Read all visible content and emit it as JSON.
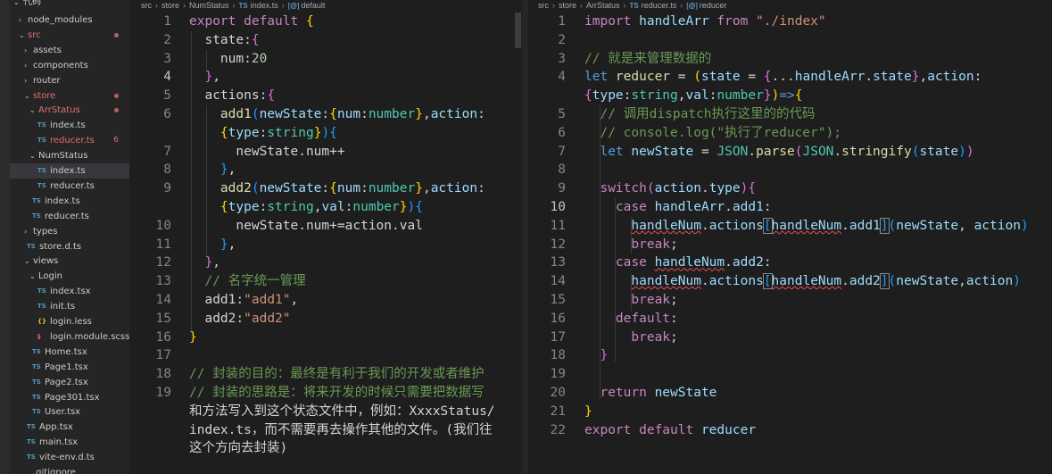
{
  "sidebar": {
    "root_label": "代码",
    "items": [
      {
        "label": "node_modules",
        "chevron": "›",
        "icon": ""
      },
      {
        "label": "src",
        "chevron": "⌄",
        "icon": "",
        "red": true
      },
      {
        "label": "assets",
        "chevron": "›",
        "icon": ""
      },
      {
        "label": "components",
        "chevron": "›",
        "icon": ""
      },
      {
        "label": "router",
        "chevron": "›",
        "icon": ""
      },
      {
        "label": "store",
        "chevron": "⌄",
        "icon": "",
        "red": true
      },
      {
        "label": "ArrStatus",
        "chevron": "⌄",
        "icon": "",
        "red": true
      },
      {
        "label": "index.ts",
        "chevron": "",
        "icon": "TS"
      },
      {
        "label": "reducer.ts",
        "chevron": "",
        "icon": "TS",
        "red": true,
        "count": "6"
      },
      {
        "label": "NumStatus",
        "chevron": "⌄",
        "icon": ""
      },
      {
        "label": "index.ts",
        "chevron": "",
        "icon": "TS",
        "selected": true
      },
      {
        "label": "reducer.ts",
        "chevron": "",
        "icon": "TS"
      },
      {
        "label": "index.ts",
        "chevron": "",
        "icon": "TS"
      },
      {
        "label": "reducer.ts",
        "chevron": "",
        "icon": "TS"
      },
      {
        "label": "types",
        "chevron": "›",
        "icon": ""
      },
      {
        "label": "store.d.ts",
        "chevron": "",
        "icon": "TS"
      },
      {
        "label": "views",
        "chevron": "⌄",
        "icon": ""
      },
      {
        "label": "Login",
        "chevron": "⌄",
        "icon": ""
      },
      {
        "label": "index.tsx",
        "chevron": "",
        "icon": "TS"
      },
      {
        "label": "init.ts",
        "chevron": "",
        "icon": "TS"
      },
      {
        "label": "login.less",
        "chevron": "",
        "icon": "{}"
      },
      {
        "label": "login.module.scss",
        "chevron": "",
        "icon": "scss"
      },
      {
        "label": "Home.tsx",
        "chevron": "",
        "icon": "TS"
      },
      {
        "label": "Page1.tsx",
        "chevron": "",
        "icon": "TS"
      },
      {
        "label": "Page2.tsx",
        "chevron": "",
        "icon": "TS"
      },
      {
        "label": "Page301.tsx",
        "chevron": "",
        "icon": "TS"
      },
      {
        "label": "User.tsx",
        "chevron": "",
        "icon": "TS"
      },
      {
        "label": "App.tsx",
        "chevron": "",
        "icon": "TS"
      },
      {
        "label": "main.tsx",
        "chevron": "",
        "icon": "TS"
      },
      {
        "label": "vite-env.d.ts",
        "chevron": "",
        "icon": "TS"
      },
      {
        "label": ".gitignore",
        "chevron": "",
        "icon": ""
      }
    ]
  },
  "left": {
    "breadcrumb": {
      "a": "src",
      "b": "store",
      "c": "NumStatus",
      "file_icon": "TS",
      "file": "index.ts",
      "symbol_icon": "[@]",
      "symbol": "default"
    },
    "current_line": "4",
    "lines": [
      {
        "n": "1",
        "t": [
          [
            "export default ",
            "kw"
          ],
          [
            "{",
            "p1"
          ]
        ]
      },
      {
        "n": "2",
        "t": [
          [
            "  state",
            ""
          ],
          [
            ":",
            ""
          ],
          [
            "{",
            "p2"
          ]
        ]
      },
      {
        "n": "3",
        "t": [
          [
            "    num",
            ""
          ],
          [
            ":",
            ""
          ],
          [
            "20",
            "num"
          ]
        ]
      },
      {
        "n": "4",
        "t": [
          [
            "  ",
            ""
          ],
          [
            "}",
            "p2"
          ],
          [
            ",",
            ""
          ]
        ]
      },
      {
        "n": "5",
        "t": [
          [
            "  actions",
            ""
          ],
          [
            ":",
            ""
          ],
          [
            "{",
            "p2"
          ]
        ]
      },
      {
        "n": "6",
        "t": [
          [
            "    ",
            ""
          ],
          [
            "add1",
            "fn"
          ],
          [
            "(",
            "p3"
          ],
          [
            "newState",
            "var"
          ],
          [
            ":",
            ""
          ],
          [
            "{",
            "p1"
          ],
          [
            "num",
            "var"
          ],
          [
            ":",
            ""
          ],
          [
            "number",
            "ty"
          ],
          [
            "}",
            "p1"
          ],
          [
            ",",
            ""
          ],
          [
            "action",
            "var"
          ],
          [
            ":",
            ""
          ]
        ]
      },
      {
        "n": "",
        "t": [
          [
            "    ",
            ""
          ],
          [
            "{",
            "p1"
          ],
          [
            "type",
            "var"
          ],
          [
            ":",
            ""
          ],
          [
            "string",
            "ty"
          ],
          [
            "}",
            "p1"
          ],
          [
            ")",
            "p3"
          ],
          [
            "{",
            "p3"
          ]
        ]
      },
      {
        "n": "7",
        "t": [
          [
            "      newState",
            ""
          ],
          [
            ".",
            ""
          ],
          [
            "num",
            ""
          ],
          [
            "++",
            ""
          ]
        ]
      },
      {
        "n": "8",
        "t": [
          [
            "    ",
            ""
          ],
          [
            "}",
            "p3"
          ],
          [
            ",",
            ""
          ]
        ]
      },
      {
        "n": "9",
        "t": [
          [
            "    ",
            ""
          ],
          [
            "add2",
            "fn"
          ],
          [
            "(",
            "p3"
          ],
          [
            "newState",
            "var"
          ],
          [
            ":",
            ""
          ],
          [
            "{",
            "p1"
          ],
          [
            "num",
            "var"
          ],
          [
            ":",
            ""
          ],
          [
            "number",
            "ty"
          ],
          [
            "}",
            "p1"
          ],
          [
            ",",
            ""
          ],
          [
            "action",
            "var"
          ],
          [
            ":",
            ""
          ]
        ]
      },
      {
        "n": "",
        "t": [
          [
            "    ",
            ""
          ],
          [
            "{",
            "p1"
          ],
          [
            "type",
            "var"
          ],
          [
            ":",
            ""
          ],
          [
            "string",
            "ty"
          ],
          [
            ",",
            ""
          ],
          [
            "val",
            "var"
          ],
          [
            ":",
            ""
          ],
          [
            "number",
            "ty"
          ],
          [
            "}",
            "p1"
          ],
          [
            ")",
            "p3"
          ],
          [
            "{",
            "p3"
          ]
        ]
      },
      {
        "n": "10",
        "t": [
          [
            "      newState",
            ""
          ],
          [
            ".",
            ""
          ],
          [
            "num",
            ""
          ],
          [
            "+=",
            ""
          ],
          [
            "action",
            ""
          ],
          [
            ".",
            ""
          ],
          [
            "val",
            ""
          ]
        ]
      },
      {
        "n": "11",
        "t": [
          [
            "    ",
            ""
          ],
          [
            "}",
            "p3"
          ],
          [
            ",",
            ""
          ]
        ]
      },
      {
        "n": "12",
        "t": [
          [
            "  ",
            ""
          ],
          [
            "}",
            "p2"
          ],
          [
            ",",
            ""
          ]
        ]
      },
      {
        "n": "13",
        "t": [
          [
            "  // 名字统一管理",
            "cm"
          ]
        ]
      },
      {
        "n": "14",
        "t": [
          [
            "  add1",
            ""
          ],
          [
            ":",
            ""
          ],
          [
            "\"add1\"",
            "str"
          ],
          [
            ",",
            ""
          ]
        ]
      },
      {
        "n": "15",
        "t": [
          [
            "  add2",
            ""
          ],
          [
            ":",
            ""
          ],
          [
            "\"add2\"",
            "str"
          ]
        ]
      },
      {
        "n": "16",
        "t": [
          [
            "",
            "op"
          ],
          [
            "}",
            "p1"
          ]
        ]
      },
      {
        "n": "17",
        "t": []
      },
      {
        "n": "18",
        "t": [
          [
            "// 封装的目的：最终是有利于我们的开发或者维护",
            "cm"
          ]
        ]
      },
      {
        "n": "19",
        "t": [
          [
            "// 封装的思路是：将来开发的时候只需要把数据写",
            "cm"
          ]
        ]
      },
      {
        "n": "",
        "t": [
          [
            "和方法写入到这个状态文件中，例如：XxxxStatus/",
            ""
          ]
        ]
      },
      {
        "n": "",
        "t": [
          [
            "index.ts，而不需要再去操作其他的文件。(我们往",
            ""
          ]
        ]
      },
      {
        "n": "",
        "t": [
          [
            "这个方向去封装)",
            ""
          ]
        ]
      }
    ]
  },
  "right": {
    "breadcrumb": {
      "a": "src",
      "b": "store",
      "c": "ArrStatus",
      "file_icon": "TS",
      "file": "reducer.ts",
      "symbol_icon": "[@]",
      "symbol": "reducer"
    },
    "current_line": "10",
    "lines": [
      {
        "n": "1",
        "t": [
          [
            "import ",
            "kw"
          ],
          [
            "handleArr",
            "var"
          ],
          [
            " from ",
            "kw"
          ],
          [
            "\"./index\"",
            "str"
          ]
        ]
      },
      {
        "n": "2",
        "t": []
      },
      {
        "n": "3",
        "t": [
          [
            "// 就是来管理数据的",
            "cm"
          ]
        ]
      },
      {
        "n": "4",
        "t": [
          [
            "let ",
            "kb"
          ],
          [
            "reducer",
            "fn"
          ],
          [
            " = ",
            ""
          ],
          [
            "(",
            "p1"
          ],
          [
            "state",
            "var"
          ],
          [
            " = ",
            ""
          ],
          [
            "{",
            "p2"
          ],
          [
            "...",
            ""
          ],
          [
            "handleArr",
            "var"
          ],
          [
            ".",
            ""
          ],
          [
            "state",
            "var"
          ],
          [
            "}",
            "p2"
          ],
          [
            ",",
            ""
          ],
          [
            "action",
            "var"
          ],
          [
            ":",
            ""
          ]
        ]
      },
      {
        "n": "",
        "t": [
          [
            "{",
            "p2"
          ],
          [
            "type",
            "var"
          ],
          [
            ":",
            ""
          ],
          [
            "string",
            "ty"
          ],
          [
            ",",
            ""
          ],
          [
            "val",
            "var"
          ],
          [
            ":",
            ""
          ],
          [
            "number",
            "ty"
          ],
          [
            "}",
            "p2"
          ],
          [
            ")",
            "p1"
          ],
          [
            "=>",
            "kb"
          ],
          [
            "{",
            "p1"
          ]
        ]
      },
      {
        "n": "5",
        "t": [
          [
            "  // 调用dispatch执行这里的的代码",
            "cm"
          ]
        ]
      },
      {
        "n": "6",
        "t": [
          [
            "  // console.log(\"执行了reducer\");",
            "cm"
          ]
        ]
      },
      {
        "n": "7",
        "t": [
          [
            "  ",
            ""
          ],
          [
            "let ",
            "kb"
          ],
          [
            "newState",
            "var"
          ],
          [
            " = ",
            ""
          ],
          [
            "JSON",
            "ty"
          ],
          [
            ".",
            ""
          ],
          [
            "parse",
            "fn"
          ],
          [
            "(",
            "p2"
          ],
          [
            "JSON",
            "ty"
          ],
          [
            ".",
            ""
          ],
          [
            "stringify",
            "fn"
          ],
          [
            "(",
            "p3"
          ],
          [
            "state",
            "var"
          ],
          [
            ")",
            "p3"
          ],
          [
            ")",
            "p2"
          ]
        ]
      },
      {
        "n": "8",
        "t": []
      },
      {
        "n": "9",
        "t": [
          [
            "  ",
            ""
          ],
          [
            "switch",
            "kw"
          ],
          [
            "(",
            "p2"
          ],
          [
            "action",
            "var"
          ],
          [
            ".",
            ""
          ],
          [
            "type",
            "var"
          ],
          [
            ")",
            "p2"
          ],
          [
            "{",
            "p2"
          ]
        ]
      },
      {
        "n": "10",
        "t": [
          [
            "    ",
            ""
          ],
          [
            "case ",
            "kw"
          ],
          [
            "handleArr",
            "var"
          ],
          [
            ".",
            ""
          ],
          [
            "add1",
            "var"
          ],
          [
            ":",
            ""
          ]
        ]
      },
      {
        "n": "11",
        "t": [
          [
            "      ",
            ""
          ],
          [
            "handleNum",
            "var sq"
          ],
          [
            ".",
            ""
          ],
          [
            "actions",
            "var"
          ],
          [
            "[",
            "p3 bx"
          ],
          [
            "handleNum",
            "var sq"
          ],
          [
            ".",
            ""
          ],
          [
            "add1",
            "var"
          ],
          [
            "]",
            "p3 bx"
          ],
          [
            "(",
            "p3"
          ],
          [
            "newState",
            "var"
          ],
          [
            ", ",
            ""
          ],
          [
            "action",
            "var"
          ],
          [
            ")",
            "p3"
          ]
        ]
      },
      {
        "n": "12",
        "t": [
          [
            "      ",
            ""
          ],
          [
            "break",
            "kw"
          ],
          [
            ";",
            ""
          ]
        ]
      },
      {
        "n": "13",
        "t": [
          [
            "    ",
            ""
          ],
          [
            "case ",
            "kw"
          ],
          [
            "handleNum",
            "var sq"
          ],
          [
            ".",
            ""
          ],
          [
            "add2",
            "var"
          ],
          [
            ":",
            ""
          ]
        ]
      },
      {
        "n": "14",
        "t": [
          [
            "      ",
            ""
          ],
          [
            "handleNum",
            "var sq"
          ],
          [
            ".",
            ""
          ],
          [
            "actions",
            "var"
          ],
          [
            "[",
            "p3 bx"
          ],
          [
            "handleNum",
            "var sq"
          ],
          [
            ".",
            ""
          ],
          [
            "add2",
            "var"
          ],
          [
            "]",
            "p3 bx"
          ],
          [
            "(",
            "p3"
          ],
          [
            "newState",
            "var"
          ],
          [
            ",",
            ""
          ],
          [
            "action",
            "var"
          ],
          [
            ")",
            "p3"
          ]
        ]
      },
      {
        "n": "15",
        "t": [
          [
            "      ",
            ""
          ],
          [
            "break",
            "kw"
          ],
          [
            ";",
            ""
          ]
        ]
      },
      {
        "n": "16",
        "t": [
          [
            "    ",
            ""
          ],
          [
            "default",
            "kw"
          ],
          [
            ":",
            ""
          ]
        ]
      },
      {
        "n": "17",
        "t": [
          [
            "      ",
            ""
          ],
          [
            "break",
            "kw"
          ],
          [
            ";",
            ""
          ]
        ]
      },
      {
        "n": "18",
        "t": [
          [
            "  ",
            ""
          ],
          [
            "}",
            "p2"
          ]
        ]
      },
      {
        "n": "19",
        "t": []
      },
      {
        "n": "20",
        "t": [
          [
            "  ",
            ""
          ],
          [
            "return ",
            "kw"
          ],
          [
            "newState",
            "var"
          ]
        ]
      },
      {
        "n": "21",
        "t": [
          [
            "",
            "op"
          ],
          [
            "}",
            "p1"
          ]
        ]
      },
      {
        "n": "22",
        "t": [
          [
            "export default ",
            "kw"
          ],
          [
            "reducer",
            "var"
          ]
        ]
      }
    ]
  },
  "colors": {
    "editor_bg": "#1e1e1e",
    "sidebar_bg": "#252526",
    "selected_row": "#37373d",
    "modified": "#e0716c"
  }
}
